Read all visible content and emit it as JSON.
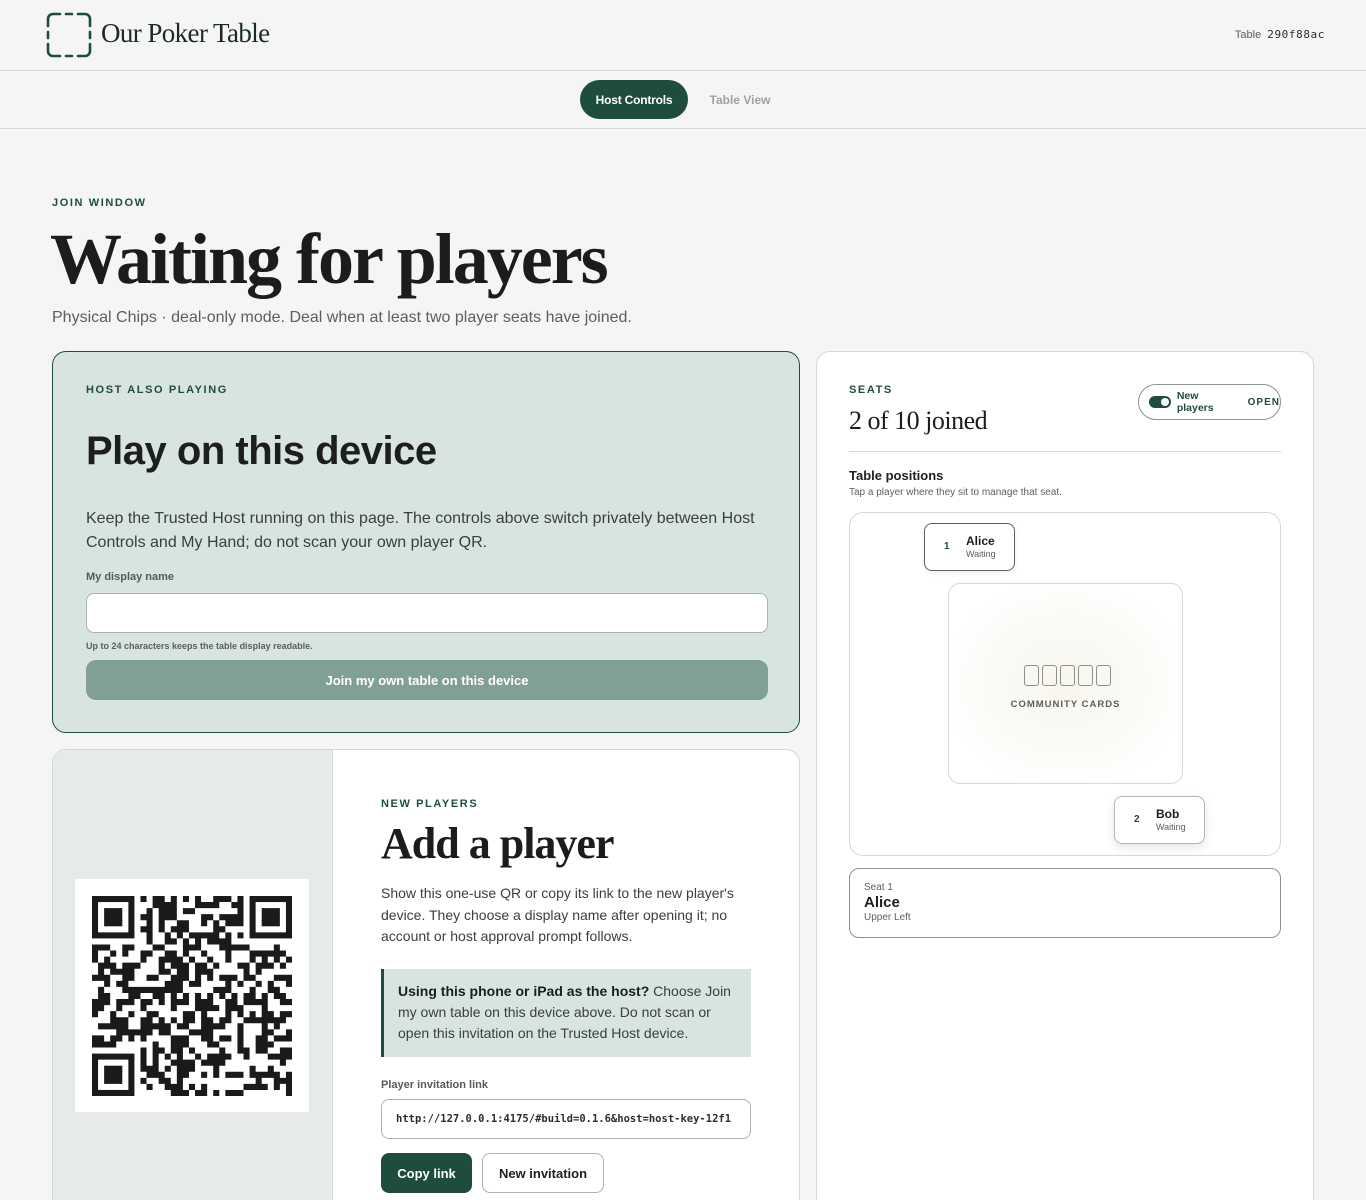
{
  "header": {
    "app_title": "Our Poker Table",
    "table_label": "Table",
    "table_code": "290f88ac"
  },
  "tabs": [
    {
      "label": "Host Controls",
      "active": true
    },
    {
      "label": "Table View",
      "active": false
    }
  ],
  "hero": {
    "eyebrow": "JOIN WINDOW",
    "title": "Waiting for players",
    "subtitle": "Physical Chips · deal-only mode. Deal when at least two player seats have joined."
  },
  "host_panel": {
    "eyebrow": "HOST ALSO PLAYING",
    "title": "Play on this device",
    "description": "Keep the Trusted Host running on this page. The controls above switch privately between Host Controls and My Hand; do not scan your own player QR.",
    "name_label": "My display name",
    "name_value": "",
    "hint": "Up to 24 characters keeps the table display readable.",
    "join_button": "Join my own table on this device"
  },
  "add_player": {
    "eyebrow": "NEW PLAYERS",
    "title": "Add a player",
    "description": "Show this one-use QR or copy its link to the new player's device. They choose a display name after opening it; no account or host approval prompt follows.",
    "callout_bold": "Using this phone or iPad as the host?",
    "callout_text": " Choose Join my own table on this device above. Do not scan or open this invitation on the Trusted Host device.",
    "link_label": "Player invitation link",
    "link_value": "http://127.0.0.1:4175/#build=0.1.6&host=host-key-12f1",
    "copy_button": "Copy link",
    "new_invitation_button": "New invitation"
  },
  "seats": {
    "eyebrow": "SEATS",
    "count_text": "2 of 10 joined",
    "toggle_label": "New players",
    "toggle_state": "OPEN",
    "positions_title": "Table positions",
    "positions_sub": "Tap a player where they sit to manage that seat.",
    "community_label": "COMMUNITY CARDS",
    "players": [
      {
        "seat": "1",
        "name": "Alice",
        "status": "Waiting"
      },
      {
        "seat": "2",
        "name": "Bob",
        "status": "Waiting"
      }
    ],
    "selected": {
      "seat_label": "Seat 1",
      "name": "Alice",
      "position": "Upper Left"
    }
  },
  "colors": {
    "accent": "#1f4d3b",
    "host_panel_bg": "#d8e4de",
    "join_button_bg": "#80a093"
  }
}
